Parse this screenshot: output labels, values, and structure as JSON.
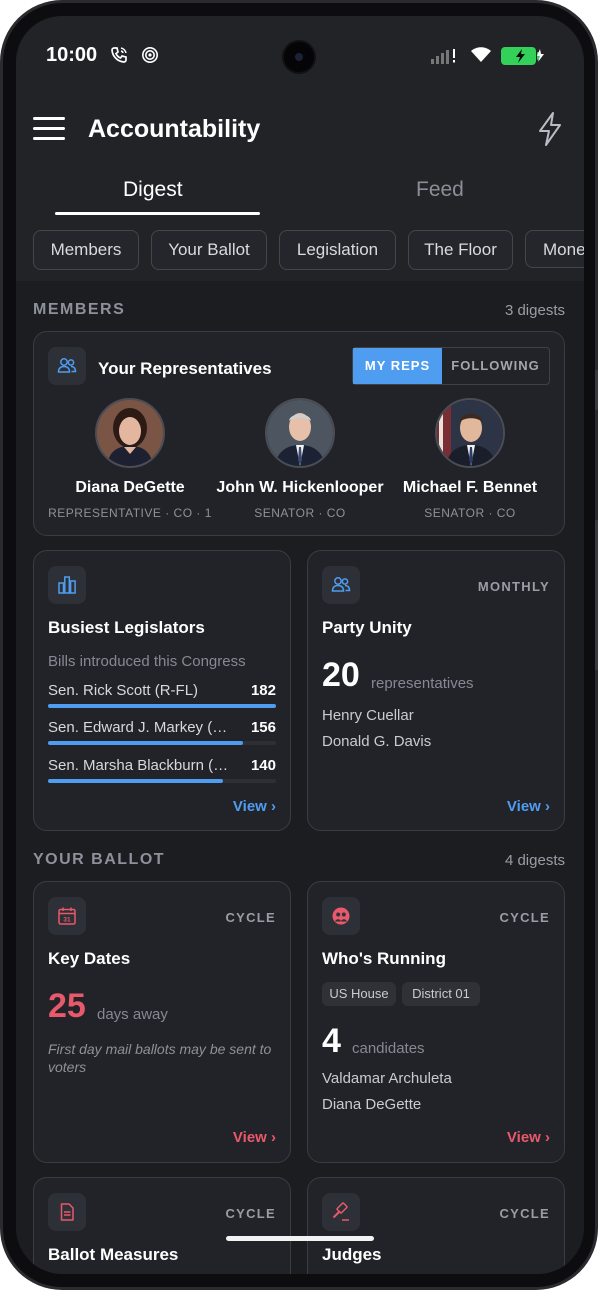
{
  "status": {
    "time": "10:00"
  },
  "app": {
    "title": "Accountability"
  },
  "tabs": [
    {
      "label": "Digest"
    },
    {
      "label": "Feed"
    }
  ],
  "chips": [
    "Members",
    "Your Ballot",
    "Legislation",
    "The Floor",
    "Mone"
  ],
  "members": {
    "header": "MEMBERS",
    "count": "3 digests",
    "reps_card": {
      "title": "Your Representatives",
      "toggle": {
        "active": "MY REPS",
        "inactive": "FOLLOWING"
      },
      "reps": [
        {
          "name": "Diana DeGette",
          "role": "REPRESENTATIVE · CO · 1"
        },
        {
          "name": "John W. Hickenlooper",
          "role": "SENATOR · CO"
        },
        {
          "name": "Michael F. Bennet",
          "role": "SENATOR · CO"
        }
      ]
    },
    "busiest": {
      "title": "Busiest Legislators",
      "subtitle": "Bills introduced this Congress",
      "rows": [
        {
          "name": "Sen. Rick Scott (R-FL)",
          "value": "182",
          "fraction": 1.0
        },
        {
          "name": "Sen. Edward J. Markey (D-MA)",
          "value": "156",
          "fraction": 0.857
        },
        {
          "name": "Sen. Marsha Blackburn (R-TN)",
          "value": "140",
          "fraction": 0.769
        }
      ],
      "view": "View ›"
    },
    "unity": {
      "tag": "MONTHLY",
      "title": "Party Unity",
      "number": "20",
      "unit": "representatives",
      "names": [
        "Henry Cuellar",
        "Donald G. Davis"
      ],
      "view": "View ›"
    }
  },
  "ballot": {
    "header": "YOUR BALLOT",
    "count": "4 digests",
    "key_dates": {
      "tag": "CYCLE",
      "title": "Key Dates",
      "number": "25",
      "unit": "days away",
      "note": "First day mail ballots may be sent to voters",
      "view": "View ›"
    },
    "running": {
      "tag": "CYCLE",
      "title": "Who's Running",
      "pills": [
        "US House",
        "District 01"
      ],
      "number": "4",
      "unit": "candidates",
      "names": [
        "Valdamar Archuleta",
        "Diana DeGette"
      ],
      "view": "View ›"
    },
    "measures": {
      "tag": "CYCLE",
      "title": "Ballot Measures"
    },
    "judges": {
      "tag": "CYCLE",
      "title": "Judges"
    }
  },
  "colors": {
    "accent_blue": "#4f9df0",
    "accent_red": "#e8596b",
    "background": "#1c1d21"
  },
  "icons": {
    "status": [
      "wifi-calling-icon",
      "hotspot-icon",
      "signal-icon",
      "wifi-icon",
      "battery-charging-icon"
    ],
    "header": [
      "menu-icon",
      "bolt-icon"
    ],
    "cards": [
      "people-icon",
      "bar-chart-icon",
      "people-icon",
      "calendar-icon",
      "candidates-icon",
      "document-icon",
      "gavel-icon"
    ]
  }
}
